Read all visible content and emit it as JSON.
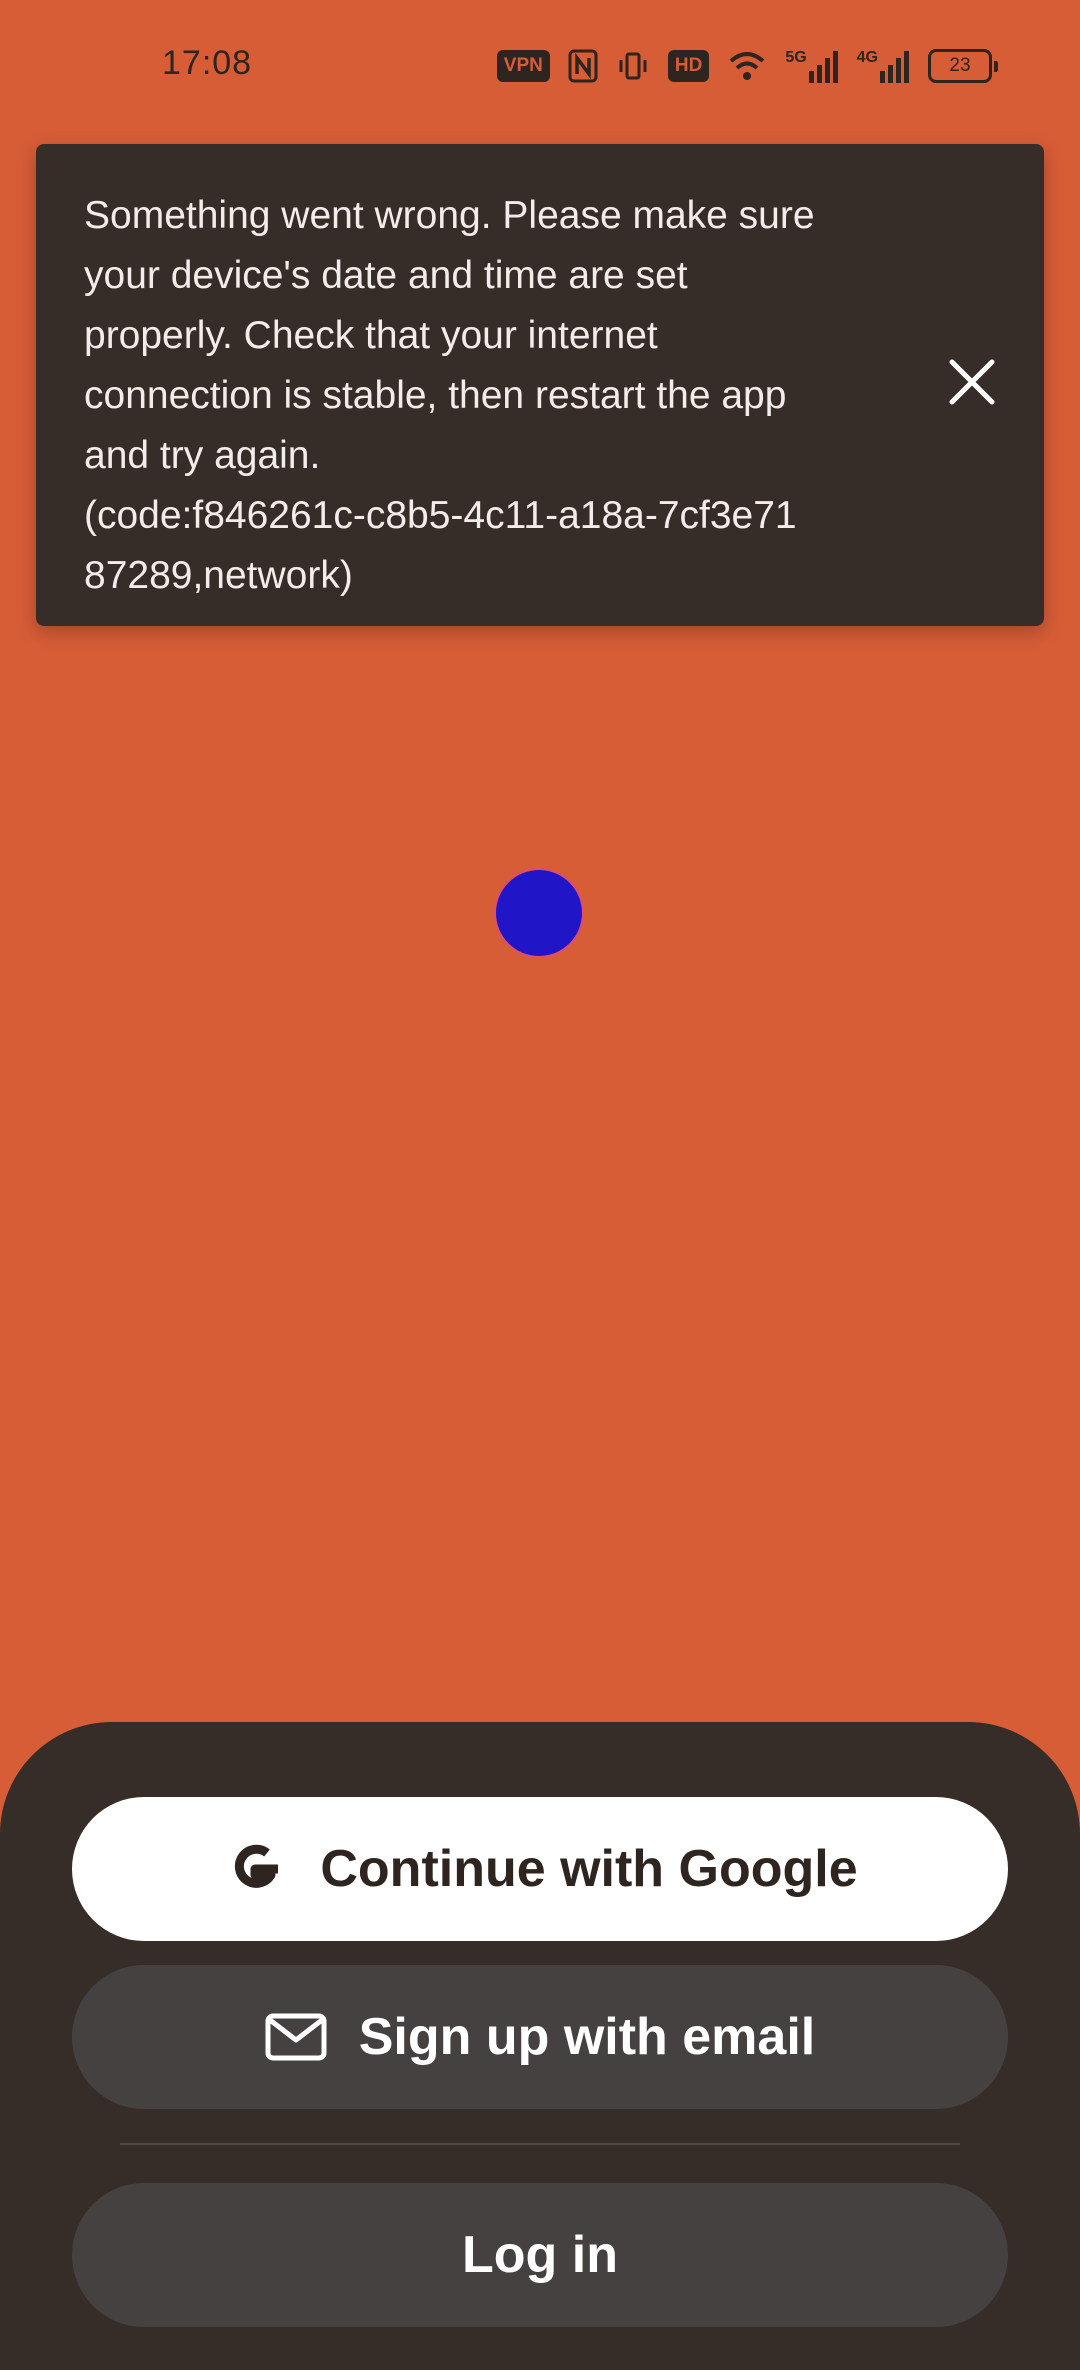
{
  "status_bar": {
    "time": "17:08",
    "vpn_badge": "VPN",
    "hd_badge": "HD",
    "network_5g": "5G",
    "network_4g": "4G",
    "battery_level": "23"
  },
  "toast": {
    "message": "Something went wrong. Please make sure\nyour device's date and time are set\nproperly. Check that your internet\nconnection is stable, then restart the app\nand try again.\n(code:f846261c-c8b5-4c11-a18a-7cf3e71\n87289,network)"
  },
  "auth": {
    "google_label": "Continue with Google",
    "email_label": "Sign up with email",
    "login_label": "Log in"
  },
  "colors": {
    "background": "#d75d37",
    "sheet": "#372d28",
    "spinner": "#2016c7"
  }
}
